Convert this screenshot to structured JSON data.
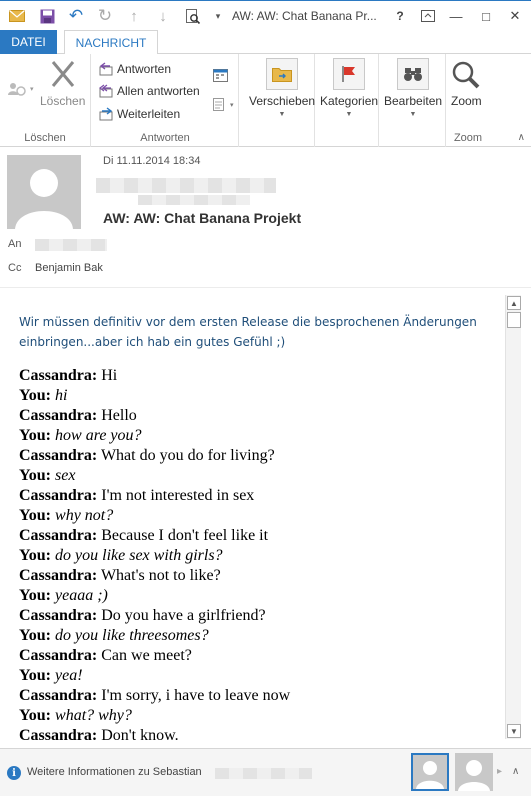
{
  "window": {
    "title": "AW: AW: Chat Banana Pr...",
    "controls": {
      "help": "?",
      "minimize": "—",
      "maximize": "□",
      "close": "✕"
    }
  },
  "tabs": {
    "file": "DATEI",
    "message": "NACHRICHT"
  },
  "ribbon": {
    "groups": {
      "delete": {
        "label": "Löschen",
        "delete_button": "Löschen"
      },
      "respond": {
        "label": "Antworten",
        "reply": "Antworten",
        "reply_all": "Allen antworten",
        "forward": "Weiterleiten"
      },
      "move": {
        "button": "Verschieben"
      },
      "tags": {
        "button": "Kategorien"
      },
      "editing": {
        "button": "Bearbeiten"
      },
      "zoom": {
        "label": "Zoom",
        "button": "Zoom"
      }
    }
  },
  "header": {
    "date": "Di 11.11.2014 18:34",
    "subject": "AW: AW: Chat Banana Projekt",
    "to_label": "An",
    "cc_label": "Cc",
    "cc_value": "Benjamin Bak"
  },
  "body": {
    "intro": "Wir müssen definitiv vor dem ersten Release die besprochenen Änderungen einbringen...aber ich hab ein gutes Gefühl ;)",
    "chat": [
      {
        "speaker": "Cassandra:",
        "text": "Hi",
        "you": false
      },
      {
        "speaker": "You:",
        "text": "hi",
        "you": true
      },
      {
        "speaker": "Cassandra:",
        "text": "Hello",
        "you": false
      },
      {
        "speaker": "You:",
        "text": "how are you?",
        "you": true
      },
      {
        "speaker": "Cassandra:",
        "text": "What do you do for living?",
        "you": false
      },
      {
        "speaker": "You:",
        "text": "sex",
        "you": true
      },
      {
        "speaker": "Cassandra:",
        "text": "I'm not interested in sex",
        "you": false
      },
      {
        "speaker": "You:",
        "text": "why not?",
        "you": true
      },
      {
        "speaker": "Cassandra:",
        "text": "Because I don't feel like it",
        "you": false
      },
      {
        "speaker": "You:",
        "text": "do you like sex with girls?",
        "you": true
      },
      {
        "speaker": "Cassandra:",
        "text": "What's not to like?",
        "you": false
      },
      {
        "speaker": "You:",
        "text": "yeaaa ;)",
        "you": true
      },
      {
        "speaker": "Cassandra:",
        "text": "Do you have a girlfriend?",
        "you": false
      },
      {
        "speaker": "You:",
        "text": "do you like threesomes?",
        "you": true
      },
      {
        "speaker": "Cassandra:",
        "text": "Can we meet?",
        "you": false
      },
      {
        "speaker": "You:",
        "text": "yea!",
        "you": true
      },
      {
        "speaker": "Cassandra:",
        "text": "I'm sorry, i have to leave now",
        "you": false
      },
      {
        "speaker": "You:",
        "text": "what? why?",
        "you": true
      },
      {
        "speaker": "Cassandra:",
        "text": "Don't know.",
        "you": false
      }
    ]
  },
  "people_pane": {
    "info_text": "Weitere Informationen zu Sebastian"
  },
  "colors": {
    "accent": "#2b79c2",
    "intro_text": "#1f4e79",
    "flag": "#d9372b",
    "folder": "#e8b84a"
  }
}
